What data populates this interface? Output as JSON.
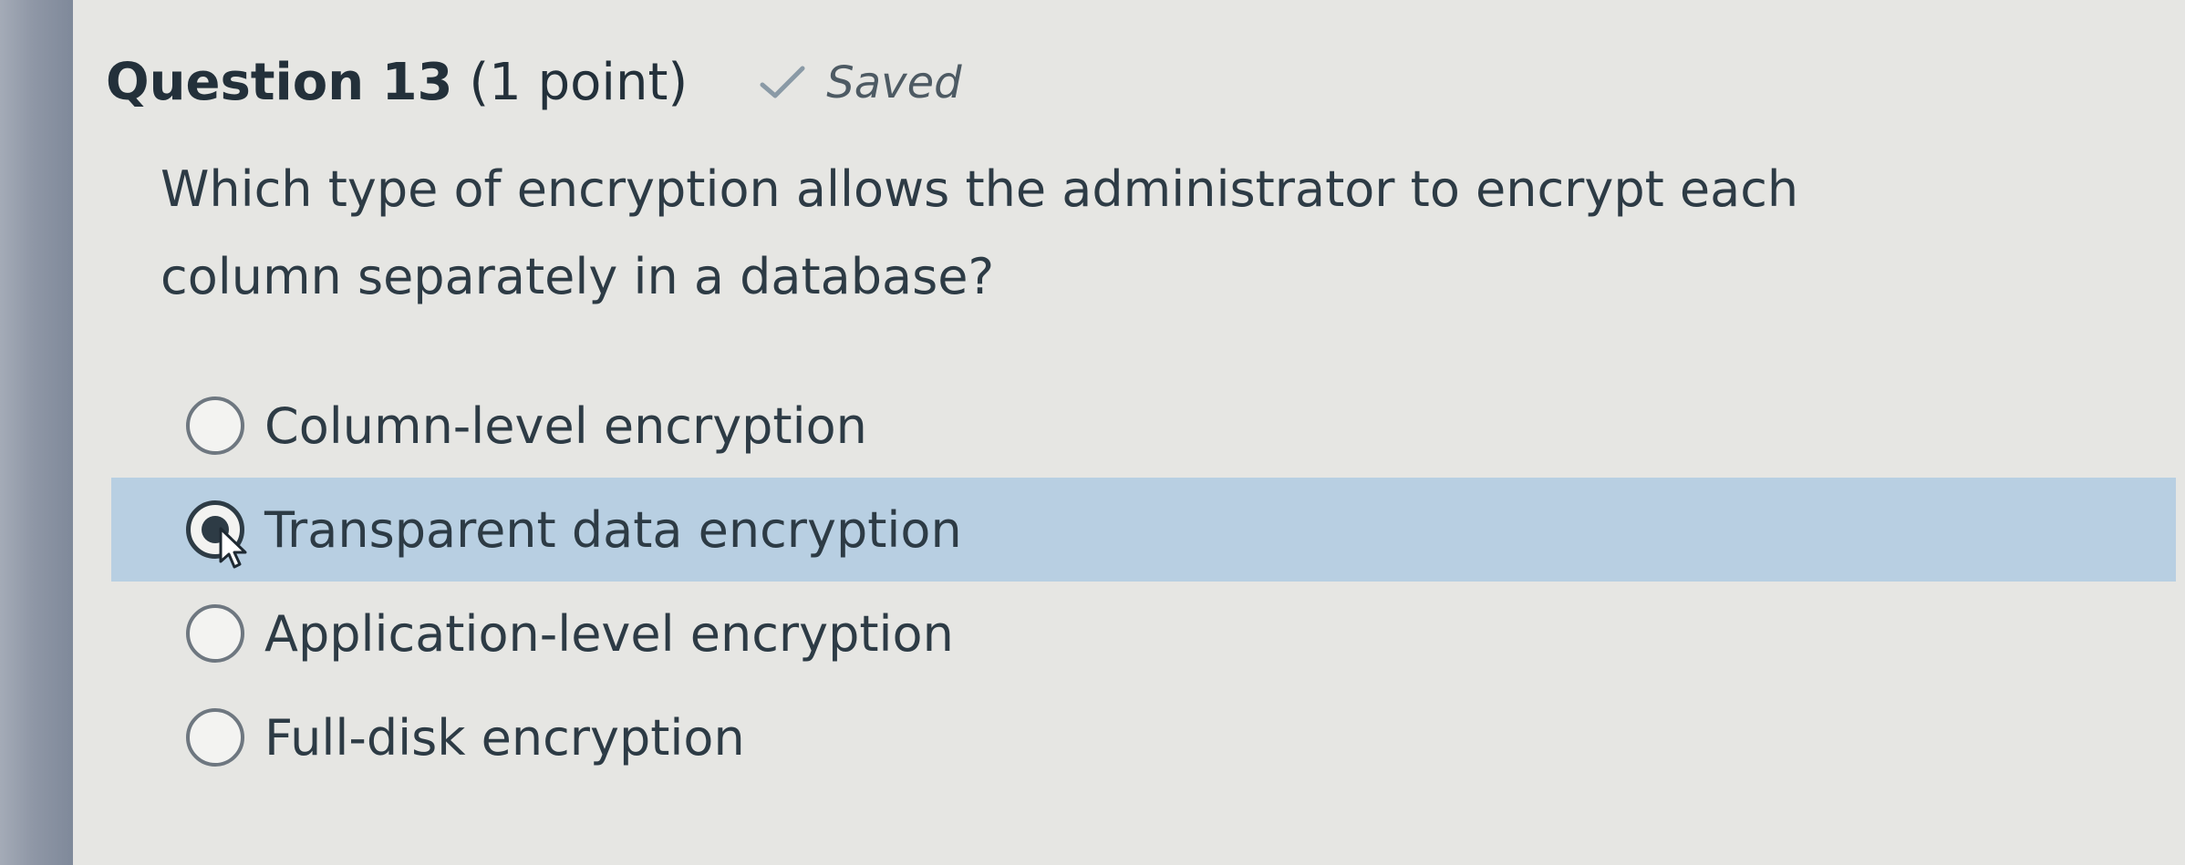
{
  "question": {
    "title_bold": "Question 13",
    "title_points": "(1 point)",
    "status": "Saved",
    "status_icon": "check-icon",
    "prompt": "Which type of encryption allows the administrator to encrypt each column separately in a database?",
    "selected_index": 1,
    "options": [
      {
        "label": "Column-level encryption"
      },
      {
        "label": "Transparent data encryption"
      },
      {
        "label": "Application-level encryption"
      },
      {
        "label": "Full-disk encryption"
      }
    ]
  },
  "colors": {
    "selected_row": "#b8cfe2",
    "text": "#2d3b45",
    "left_bar": "#8f97a6"
  }
}
